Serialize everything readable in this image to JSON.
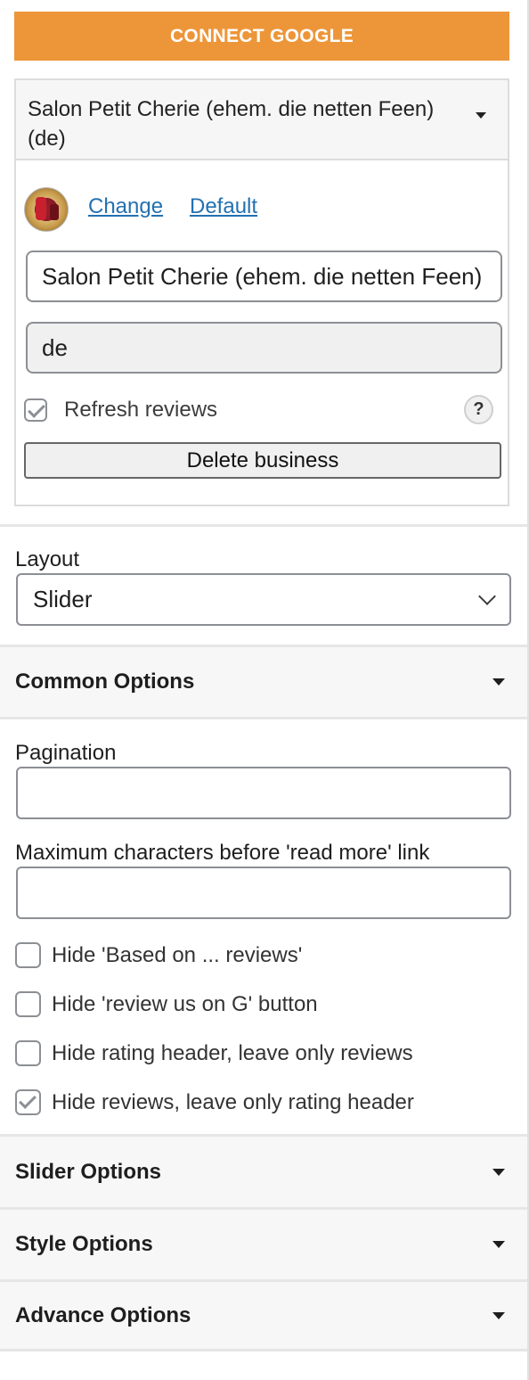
{
  "connect_button": "CONNECT GOOGLE",
  "business": {
    "select_value": "Salon Petit Cherie (ehem. die netten Feen) (de)",
    "change_link": "Change",
    "default_link": "Default",
    "name_value": "Salon Petit Cherie (ehem. die netten Feen)",
    "lang_value": "de",
    "refresh_label": "Refresh reviews",
    "refresh_checked": true,
    "help_label": "?",
    "delete_button": "Delete business"
  },
  "layout": {
    "label": "Layout",
    "value": "Slider"
  },
  "common_options": {
    "title": "Common Options",
    "pagination_label": "Pagination",
    "pagination_value": "",
    "max_chars_label": "Maximum characters before 'read more' link",
    "max_chars_value": "",
    "options": [
      {
        "label": "Hide 'Based on ... reviews'",
        "checked": false
      },
      {
        "label": "Hide 'review us on G' button",
        "checked": false
      },
      {
        "label": "Hide rating header, leave only reviews",
        "checked": false
      },
      {
        "label": "Hide reviews, leave only rating header",
        "checked": true
      }
    ]
  },
  "sections": {
    "slider": "Slider Options",
    "style": "Style Options",
    "advance": "Advance Options"
  },
  "colors": {
    "accent_orange": "#ed9639",
    "link_blue": "#2271b1"
  }
}
